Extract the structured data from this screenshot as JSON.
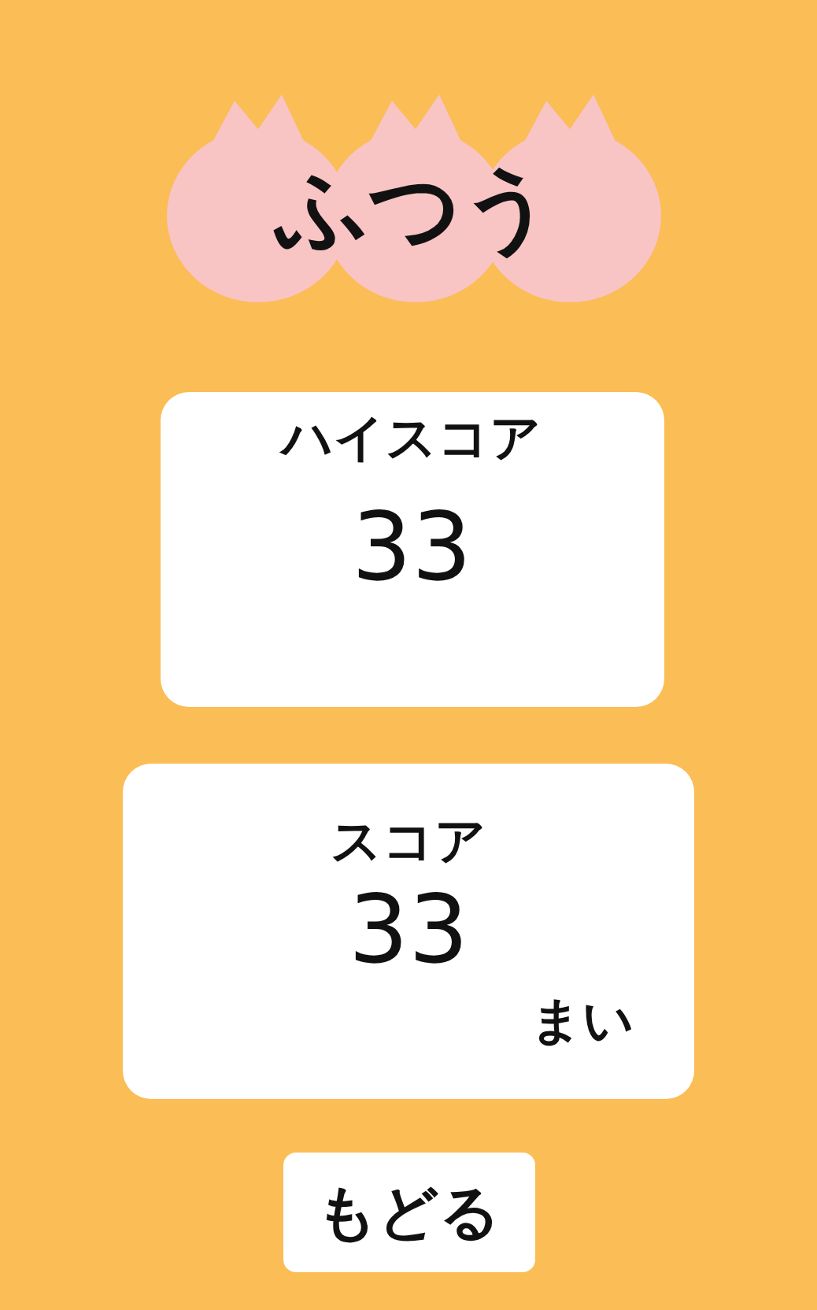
{
  "title": "ふつう",
  "high_score": {
    "label": "ハイスコア",
    "value": "33"
  },
  "score": {
    "label": "スコア",
    "value": "33",
    "unit": "まい"
  },
  "back_button": "もどる"
}
